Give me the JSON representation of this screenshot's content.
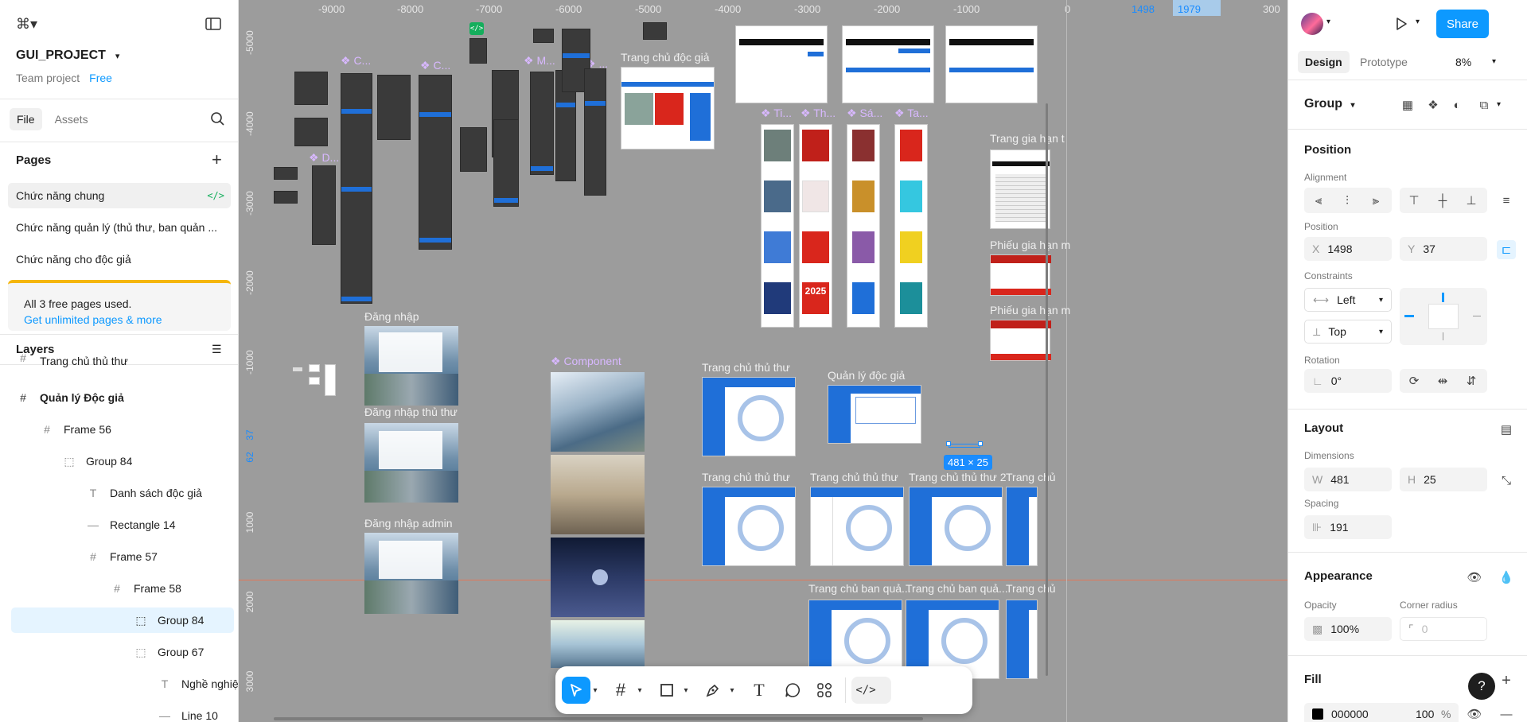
{
  "app": {
    "project_name": "GUI_PROJECT",
    "team": "Team project",
    "plan_badge": "Free"
  },
  "left_tabs": {
    "file": "File",
    "assets": "Assets"
  },
  "pages": {
    "title": "Pages",
    "items": [
      {
        "label": "Chức năng chung",
        "selected": true,
        "badge": "</>"
      },
      {
        "label": "Chức năng quản lý (thủ thư, ban quản ..."
      },
      {
        "label": "Chức năng cho độc giả"
      }
    ],
    "banner_text": "All 3 free pages used.",
    "banner_link": "Get unlimited pages & more"
  },
  "layers": {
    "title": "Layers",
    "items": [
      {
        "label": "Trang chủ thủ thư",
        "icon": "frame-icon",
        "level": 0
      },
      {
        "label": "Quản lý Độc giả",
        "icon": "frame-icon",
        "level": 0,
        "bold": true
      },
      {
        "label": "Frame 56",
        "icon": "frame-icon",
        "level": 1
      },
      {
        "label": "Group 84",
        "icon": "group-icon",
        "level": 2
      },
      {
        "label": "Danh sách độc giả",
        "icon": "text-icon",
        "level": 3
      },
      {
        "label": "Rectangle 14",
        "icon": "line-icon",
        "level": 3
      },
      {
        "label": "Frame 57",
        "icon": "frame-icon",
        "level": 3
      },
      {
        "label": "Frame 58",
        "icon": "frame-icon",
        "level": 4
      },
      {
        "label": "Group 84",
        "icon": "group-icon",
        "level": 5,
        "selected": true
      },
      {
        "label": "Group 67",
        "icon": "group-icon",
        "level": 5
      },
      {
        "label": "Nghề nghiệ",
        "icon": "text-icon",
        "level": 6
      },
      {
        "label": "Line 10",
        "icon": "line-icon",
        "level": 6
      }
    ]
  },
  "canvas": {
    "ruler_top": [
      "-9000",
      "-8000",
      "-7000",
      "-6000",
      "-5000",
      "-4000",
      "-3000",
      "-2000",
      "-1000",
      "0",
      "1498",
      "1979",
      "300"
    ],
    "ruler_left": [
      "-5000",
      "-4000",
      "-3000",
      "-2000",
      "-1000",
      "37",
      "62",
      "1000",
      "2000",
      "3000"
    ],
    "frames": {
      "trang_chu_doc_gia": "Trang chủ độc giả",
      "dang_nhap": "Đăng nhập",
      "dang_nhap_thu_thu": "Đăng nhập thủ thư",
      "dang_nhap_admin": "Đăng nhập admin",
      "component": "❖ Component",
      "trang_chu_thu_thu": "Trang chủ thủ thư",
      "quan_ly_doc_gia": "Quản lý độc giả",
      "trang_chu_thu_thu_b": "Trang chủ thủ thư",
      "trang_chu_thu_thu_c": "Trang chủ thủ thư",
      "trang_chu_thu_thu_2": "Trang chủ thủ thư 2",
      "trang_chu_cut": "Trang chủ",
      "trang_chu_ban_qua_1": "Trang chủ ban quả...",
      "trang_chu_ban_qua_2": "Trang chủ ban quả...",
      "trang_chu_cut_2": "Trang chủ",
      "trang_gia_han": "Trang gia hạn t",
      "phieu_gia_han_1": "Phiếu gia hạn m",
      "phieu_gia_han_2": "Phiếu gia hạn m",
      "comp_ti": "❖ Ti...",
      "comp_th": "❖ Th...",
      "comp_sa": "❖ Sá...",
      "comp_ta": "❖ Ta...",
      "comp_c1": "❖ C...",
      "comp_c2": "❖ C...",
      "comp_m": "❖ M...",
      "comp_dots": "❖ ...",
      "comp_d": "❖ D..."
    },
    "selection_size": "481 × 25",
    "code_badge": "</>",
    "book_2025": "2025"
  },
  "right": {
    "tabs": {
      "design": "Design",
      "prototype": "Prototype"
    },
    "zoom": "8%",
    "share": "Share",
    "selection_type": "Group",
    "position": {
      "title": "Position",
      "alignment_label": "Alignment",
      "position_label": "Position",
      "x_prefix": "X",
      "x": "1498",
      "y_prefix": "Y",
      "y": "37",
      "constraints_label": "Constraints",
      "h_constraint": "Left",
      "v_constraint": "Top",
      "rotation_label": "Rotation",
      "rotation": "0°"
    },
    "layout": {
      "title": "Layout",
      "dimensions_label": "Dimensions",
      "w_prefix": "W",
      "w": "481",
      "h_prefix": "H",
      "h": "25",
      "spacing_label": "Spacing",
      "spacing": "191"
    },
    "appearance": {
      "title": "Appearance",
      "opacity_label": "Opacity",
      "opacity": "100%",
      "radius_label": "Corner radius",
      "radius": "0"
    },
    "fill": {
      "title": "Fill",
      "color": "000000",
      "opacity": "100",
      "unit": "%"
    },
    "help": "?"
  },
  "colors": {
    "accent": "#0d99ff",
    "canvas": "#9c9c9c",
    "selected_row": "#e5f4ff",
    "upgrade_bar": "#f5b60b",
    "component": "#d8b8ff",
    "poster_red": "#d9261c"
  }
}
